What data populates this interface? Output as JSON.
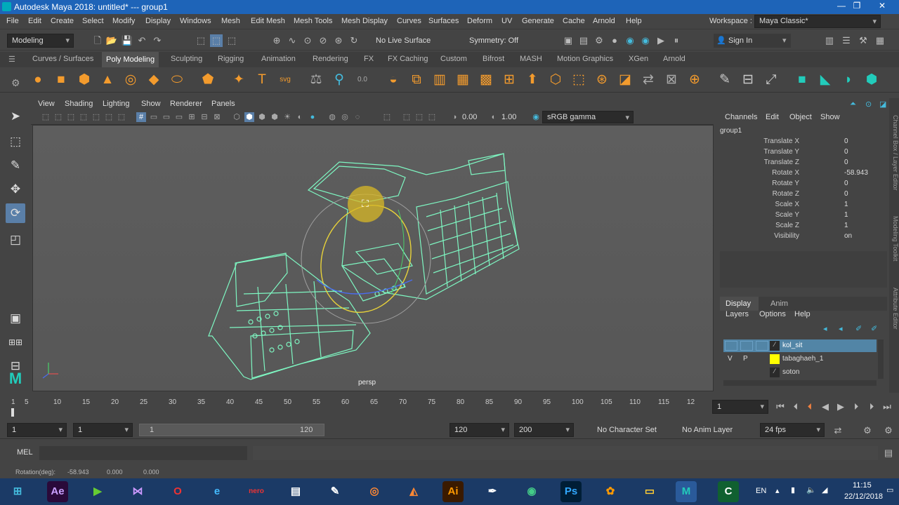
{
  "window": {
    "title": "Autodesk Maya 2018: untitled*   ---   group1",
    "controls": [
      "—",
      "❐",
      "✕"
    ]
  },
  "menubar": [
    "File",
    "Edit",
    "Create",
    "Select",
    "Modify",
    "Display",
    "Windows",
    "Mesh",
    "Edit Mesh",
    "Mesh Tools",
    "Mesh Display",
    "Curves",
    "Surfaces",
    "Deform",
    "UV",
    "Generate",
    "Cache",
    "Arnold",
    "Help"
  ],
  "workspace": {
    "label": "Workspace :",
    "value": "Maya Classic*"
  },
  "statusline": {
    "mode": "Modeling",
    "live_surface": "No Live Surface",
    "symmetry": "Symmetry: Off",
    "signin": "Sign In"
  },
  "shelf_tabs": [
    "Curves / Surfaces",
    "Poly Modeling",
    "Sculpting",
    "Rigging",
    "Animation",
    "Rendering",
    "FX",
    "FX Caching",
    "Custom",
    "Bifrost",
    "MASH",
    "Motion Graphics",
    "XGen",
    "Arnold"
  ],
  "shelf_active": "Poly Modeling",
  "panel_menu": [
    "View",
    "Shading",
    "Lighting",
    "Show",
    "Renderer",
    "Panels"
  ],
  "panel_toolbar": {
    "exposure": "0.00",
    "gamma": "1.00",
    "color_space": "sRGB gamma"
  },
  "viewport": {
    "camera_label": "persp"
  },
  "channelbox": {
    "menus": [
      "Channels",
      "Edit",
      "Object",
      "Show"
    ],
    "object": "group1",
    "attributes": [
      {
        "name": "Translate X",
        "value": "0"
      },
      {
        "name": "Translate Y",
        "value": "0"
      },
      {
        "name": "Translate Z",
        "value": "0"
      },
      {
        "name": "Rotate X",
        "value": "-58.943"
      },
      {
        "name": "Rotate Y",
        "value": "0"
      },
      {
        "name": "Rotate Z",
        "value": "0"
      },
      {
        "name": "Scale X",
        "value": "1"
      },
      {
        "name": "Scale Y",
        "value": "1"
      },
      {
        "name": "Scale Z",
        "value": "1"
      },
      {
        "name": "Visibility",
        "value": "on"
      }
    ]
  },
  "layer_editor": {
    "tabs": [
      "Display",
      "Anim"
    ],
    "menus": [
      "Layers",
      "Options",
      "Help"
    ],
    "layers": [
      {
        "v": "",
        "p": "",
        "name": "kol_sit",
        "color": "#2a2a2a",
        "selected": true
      },
      {
        "v": "V",
        "p": "P",
        "name": "tabaghaeh_1",
        "color": "#ffff00",
        "selected": false
      },
      {
        "v": "",
        "p": "",
        "name": "soton",
        "color": "#2a2a2a",
        "selected": false
      }
    ]
  },
  "side_labels": [
    "Channel Box / Layer Editor",
    "Modeling Toolkit",
    "Attribute Editor"
  ],
  "timeline": {
    "ticks": [
      "1",
      "5",
      "10",
      "15",
      "20",
      "25",
      "30",
      "35",
      "40",
      "45",
      "50",
      "55",
      "60",
      "65",
      "70",
      "75",
      "80",
      "85",
      "90",
      "95",
      "100",
      "105",
      "110",
      "115",
      "12"
    ],
    "current_frame": "1"
  },
  "range": {
    "start": "1",
    "playback_start": "1",
    "slider_start": "1",
    "slider_end": "120",
    "playback_end": "120",
    "end": "200",
    "character": "No Character Set",
    "anim_layer": "No Anim Layer",
    "fps": "24 fps"
  },
  "mel": {
    "label": "MEL"
  },
  "helpline": {
    "label": "Rotation(deg):",
    "x": "-58.943",
    "y": "0.000",
    "z": "0.000"
  },
  "taskbar": {
    "lang": "EN",
    "time": "11:15",
    "date": "22/12/2018"
  }
}
